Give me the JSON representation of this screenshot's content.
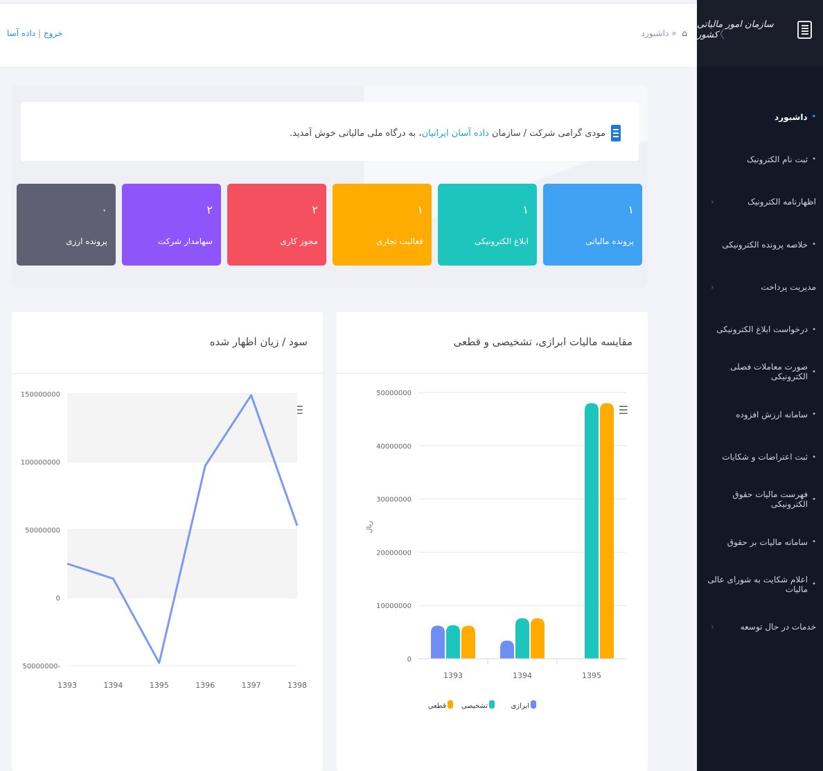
{
  "topbar": {
    "exit_label": "خروج",
    "separator": "|",
    "user_label": "داده آسا",
    "breadcrumb_sep": "«",
    "breadcrumb": "داشبورد"
  },
  "sidebar": {
    "logo_text": "سازمان امور مالیاتی کشور",
    "toggle": "〈",
    "items": [
      {
        "label": "داشبورد",
        "active": true,
        "bullet": true,
        "arrow": false
      },
      {
        "label": "ثبت نام الکترونیک",
        "bullet": true,
        "arrow": false
      },
      {
        "label": "اظهارنامه الکترونیک",
        "bullet": false,
        "arrow": true
      },
      {
        "label": "خلاصه پرونده الکترونیکی",
        "bullet": true,
        "arrow": false
      },
      {
        "label": "مدیریت پرداخت",
        "bullet": false,
        "arrow": true
      },
      {
        "label": "درخواست ابلاغ الکترونیکی",
        "bullet": true,
        "arrow": false
      },
      {
        "label": "صورت معاملات فصلی الکترونیکی",
        "bullet": true,
        "arrow": false
      },
      {
        "label": "سامانه ارزش افزوده",
        "bullet": true,
        "arrow": false
      },
      {
        "label": "ثبت اعتراضات و شکایات",
        "bullet": true,
        "arrow": false
      },
      {
        "label": "فهرست مالیات حقوق الکترونیکی",
        "bullet": true,
        "arrow": false
      },
      {
        "label": "سامانه مالیات بر حقوق",
        "bullet": true,
        "arrow": false
      },
      {
        "label": "اعلام شکایت به شورای عالی مالیات",
        "bullet": true,
        "arrow": false
      },
      {
        "label": "خدمات در حال توسعه",
        "bullet": false,
        "arrow": true
      }
    ]
  },
  "welcome": {
    "before": "مودی گرامی شرکت / سازمان",
    "company": "داده آسان ایرانیان",
    "after": "، به درگاه ملی مالیاتی خوش آمدید."
  },
  "cards": [
    {
      "num": "۱",
      "label": "پرونده مالیاتی",
      "color": "#3ea1f2"
    },
    {
      "num": "۱",
      "label": "ابلاغ الکترونیکی",
      "color": "#1ec5bd"
    },
    {
      "num": "۱",
      "label": "فعالیت تجاری",
      "color": "#ffab00"
    },
    {
      "num": "۲",
      "label": "مجوز کاری",
      "color": "#f5505f"
    },
    {
      "num": "۲",
      "label": "سهامدار شرکت",
      "color": "#8e55fb"
    },
    {
      "num": "۰",
      "label": "پرونده ارزی",
      "color": "#5f6073"
    }
  ],
  "charts": {
    "bar_title": "مقایسه مالیات ابرازی، تشخیصی و قطعی",
    "line_title": "سود / زیان اظهار شده"
  },
  "chart_data": [
    {
      "type": "bar",
      "title": "مقایسه مالیات ابرازی، تشخیصی و قطعی",
      "ylabel": "ریال",
      "categories": [
        "1393",
        "1394",
        "1395"
      ],
      "ylim": [
        0,
        50000000
      ],
      "yticks": [
        "0",
        "10000000",
        "20000000",
        "30000000",
        "40000000",
        "50000000"
      ],
      "series": [
        {
          "name": "ابرازی",
          "color": "#6f8ef2",
          "values": [
            6200000,
            3400000,
            0
          ]
        },
        {
          "name": "تشخیصی",
          "color": "#1ec5bd",
          "values": [
            6300000,
            7600000,
            48000000
          ]
        },
        {
          "name": "قطعی",
          "color": "#ffab00",
          "values": [
            6200000,
            7600000,
            48000000
          ]
        }
      ],
      "legend": "bottom"
    },
    {
      "type": "line",
      "title": "سود / زیان اظهار شده",
      "x": [
        "1393",
        "1394",
        "1395",
        "1396",
        "1397",
        "1398"
      ],
      "values": [
        25000000,
        14000000,
        -48000000,
        97000000,
        149000000,
        53000000
      ],
      "ylim": [
        -50000000,
        150000000
      ],
      "yticks": [
        "50000000-",
        "0",
        "50000000",
        "100000000",
        "150000000"
      ],
      "color": "#7b9af0"
    }
  ]
}
